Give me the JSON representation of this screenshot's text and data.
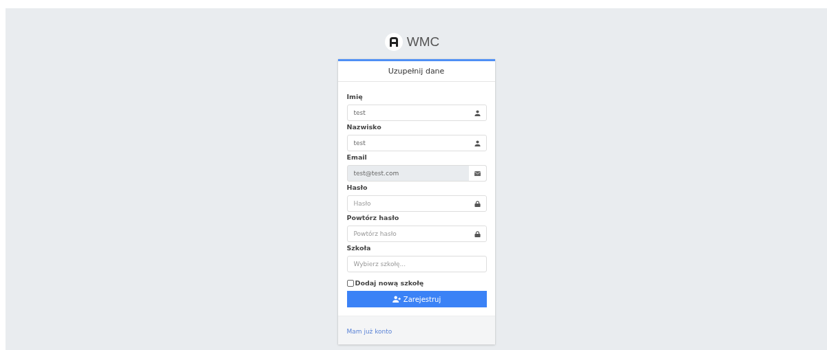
{
  "brand": {
    "name": "WMC"
  },
  "card": {
    "title": "Uzupełnij dane"
  },
  "fields": [
    {
      "label": "Imię",
      "value": "test",
      "kind": "name",
      "disabled": false
    },
    {
      "label": "Nazwisko",
      "value": "test",
      "kind": "name",
      "disabled": false
    },
    {
      "label": "Email",
      "value": "test@test.com",
      "kind": "email",
      "disabled": true
    },
    {
      "label": "Hasło",
      "placeholder": "Hasło",
      "kind": "password",
      "disabled": false
    },
    {
      "label": "Powtórz hasło",
      "placeholder": "Powtórz hasło",
      "kind": "password",
      "disabled": false
    },
    {
      "label": "Szkoła",
      "placeholder": "Wybierz szkołę...",
      "kind": "select",
      "disabled": false
    }
  ],
  "checkbox": {
    "label": "Dodaj nową szkołę",
    "checked": false
  },
  "submit": {
    "label": "Zarejestruj"
  },
  "footer_link": "Mam już konto"
}
